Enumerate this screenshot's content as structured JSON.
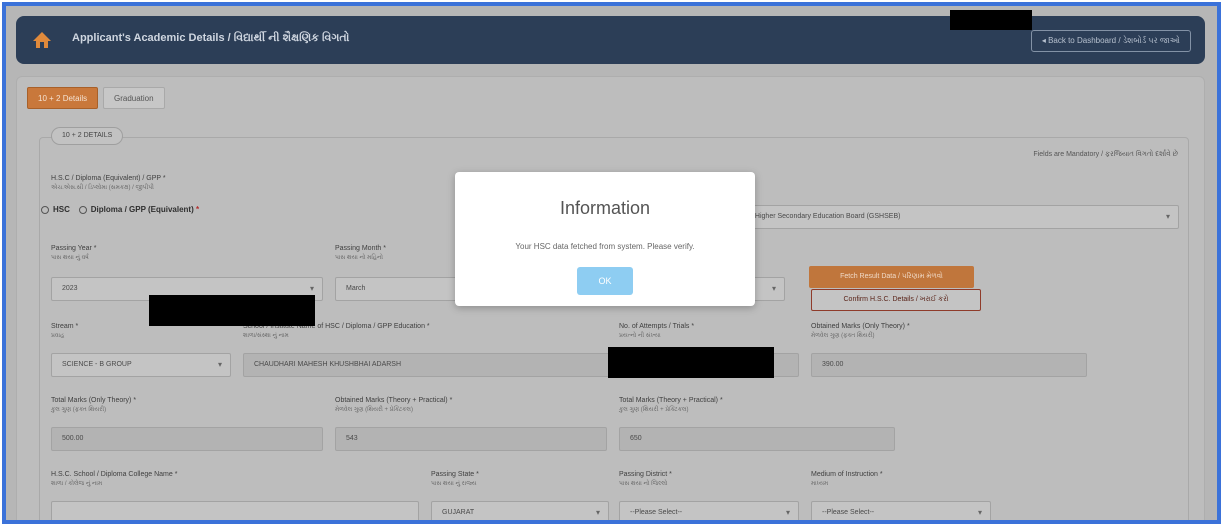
{
  "header": {
    "title": "Applicant's Academic Details / વિદ્યાર્થી ની શૈક્ષણિક વિગતો",
    "back_label": "◂ Back to Dashboard / ડેશબોર્ડ પર જાઓ"
  },
  "tabs": [
    {
      "label": "10 + 2 Details",
      "active": true
    },
    {
      "label": "Graduation",
      "active": false
    }
  ],
  "section": {
    "legend": "10 + 2 DETAILS",
    "notice": "Fields are Mandatory / ફરજિયાત વિગતો દર્શાવે છે"
  },
  "form": {
    "type_label": "H.S.C / Diploma (Equivalent) / GPP *",
    "type_sub": "એચ.એસ.સી / ડિપ્લોમા (સમકક્ષ) / જીપીપી",
    "options": [
      "HSC",
      "Diploma / GPP (Equivalent)"
    ],
    "board_value": "Gujarat Secondary & Higher Secondary Education Board (GSHSEB)",
    "passing_year_label": "Passing Year *",
    "passing_year_sub": "પાસ થયા નું વર્ષ",
    "passing_year_value": "2023",
    "passing_month_label": "Passing Month *",
    "passing_month_sub": "પાસ થયા નો મહિનો",
    "passing_month_value": "March",
    "fetch_button": "Fetch Result Data / પરિણામ મેળવો",
    "confirm_button": "Confirm H.S.C. Details / ખરાઈ કરો",
    "stream_label": "Stream *",
    "stream_sub": "પ્રવાહ",
    "stream_value": "SCIENCE - B GROUP",
    "school_label": "School / Institute Name of HSC / Diploma / GPP Education *",
    "school_sub": "શાળા/સંસ્થા નું નામ",
    "school_value": "CHAUDHARI MAHESH KHUSHBHAI ADARSH",
    "seat_label": "No. of Attempts / Trials *",
    "seat_sub": "પ્રયત્નો ની સંખ્યા",
    "obtained_label": "Obtained Marks (Only Theory) *",
    "obtained_sub": "મેળવેલ ગુણ (ફક્ત થિયરી)",
    "obtained_value": "390.00",
    "total_label": "Total Marks (Only Theory) *",
    "total_sub": "કુલ ગુણ (ફક્ત થિયરી)",
    "total_value": "500.00",
    "obtained_pf_label": "Obtained Marks (Theory + Practical) *",
    "obtained_pf_sub": "મેળવેલ ગુણ (થિયરી + પ્રેક્ટિકલ)",
    "obtained_pf_value": "543",
    "total_pf_label": "Total Marks (Theory + Practical) *",
    "total_pf_sub": "કુલ ગુણ (થિયરી + પ્રેક્ટિકલ)",
    "total_pf_value": "650",
    "college_label": "H.S.C. School / Diploma College Name *",
    "college_sub": "શાળા / કોલેજ નું નામ",
    "state_label": "Passing State *",
    "state_sub": "પાસ થયા નું રાજ્ય",
    "state_value": "GUJARAT",
    "district_label": "Passing District *",
    "district_sub": "પાસ થયા નો જિલ્લો",
    "district_value": "--Please Select--",
    "medium_label": "Medium of Instruction *",
    "medium_sub": "માધ્યમ",
    "medium_value": "--Please Select--"
  },
  "modal": {
    "title": "Information",
    "message": "Your HSC data fetched from system. Please verify.",
    "ok_label": "OK"
  },
  "colors": {
    "accent": "#c9783b",
    "header_bg": "#2c3e57",
    "frame_border": "#3b72d9",
    "modal_ok": "#8ecdf2"
  }
}
